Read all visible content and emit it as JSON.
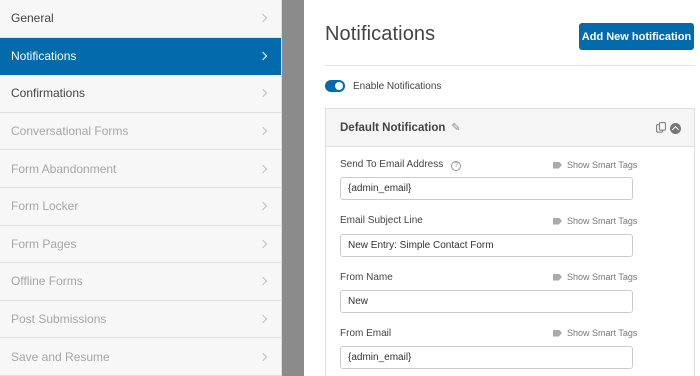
{
  "sidebar": {
    "items": [
      {
        "label": "General",
        "state": "normal"
      },
      {
        "label": "Notifications",
        "state": "active"
      },
      {
        "label": "Confirmations",
        "state": "normal"
      },
      {
        "label": "Conversational Forms",
        "state": "disabled"
      },
      {
        "label": "Form Abandonment",
        "state": "disabled"
      },
      {
        "label": "Form Locker",
        "state": "disabled"
      },
      {
        "label": "Form Pages",
        "state": "disabled"
      },
      {
        "label": "Offline Forms",
        "state": "disabled"
      },
      {
        "label": "Post Submissions",
        "state": "disabled"
      },
      {
        "label": "Save and Resume",
        "state": "disabled"
      }
    ]
  },
  "main": {
    "title": "Notifications",
    "add_button_label": "Add New hotification",
    "enable_toggle": {
      "label": "Enable Notifications",
      "on": true
    },
    "card": {
      "title": "Default Notification",
      "fields": [
        {
          "label": "Send To Email Address",
          "help": true,
          "smart_tags": "Show Smart Tags",
          "value": "{admin_email}"
        },
        {
          "label": "Email Subject Line",
          "help": false,
          "smart_tags": "Show Smart Tags",
          "value": "New Entry: Simple Contact Form"
        },
        {
          "label": "From Name",
          "help": false,
          "smart_tags": "Show Smart Tags",
          "value": "New"
        },
        {
          "label": "From Email",
          "help": false,
          "smart_tags": "Show Smart Tags",
          "value": "{admin_email}"
        }
      ]
    }
  },
  "colors": {
    "accent": "#036aab",
    "sidebar_bg": "#f7f7f7",
    "gutter": "#8b8b8b"
  }
}
